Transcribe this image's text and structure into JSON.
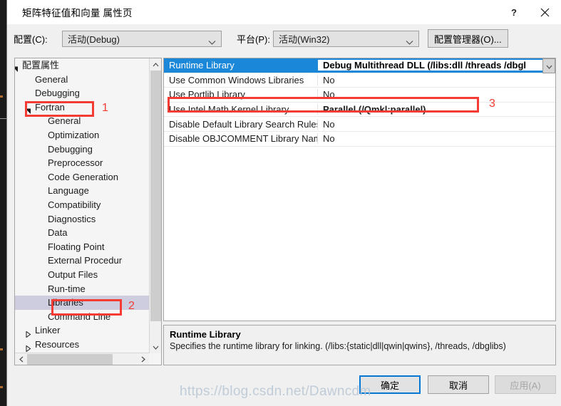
{
  "window": {
    "title": "矩阵特征值和向量 属性页",
    "help_label": "?",
    "close_label": "✕",
    "help_icon": "question-mark-icon",
    "close_icon": "close-icon"
  },
  "config_bar": {
    "config_label": "配置(C):",
    "config_value": "活动(Debug)",
    "platform_label": "平台(P):",
    "platform_value": "活动(Win32)",
    "config_manager_button": "配置管理器(O)..."
  },
  "tree": {
    "items": [
      {
        "label": "配置属性",
        "indent": 0,
        "glyph": "expanded",
        "selected": false
      },
      {
        "label": "General",
        "indent": 1,
        "glyph": "none",
        "selected": false
      },
      {
        "label": "Debugging",
        "indent": 1,
        "glyph": "none",
        "selected": false
      },
      {
        "label": "Fortran",
        "indent": 1,
        "glyph": "expanded",
        "selected": false
      },
      {
        "label": "General",
        "indent": 2,
        "glyph": "none",
        "selected": false
      },
      {
        "label": "Optimization",
        "indent": 2,
        "glyph": "none",
        "selected": false
      },
      {
        "label": "Debugging",
        "indent": 2,
        "glyph": "none",
        "selected": false
      },
      {
        "label": "Preprocessor",
        "indent": 2,
        "glyph": "none",
        "selected": false
      },
      {
        "label": "Code Generation",
        "indent": 2,
        "glyph": "none",
        "selected": false
      },
      {
        "label": "Language",
        "indent": 2,
        "glyph": "none",
        "selected": false
      },
      {
        "label": "Compatibility",
        "indent": 2,
        "glyph": "none",
        "selected": false
      },
      {
        "label": "Diagnostics",
        "indent": 2,
        "glyph": "none",
        "selected": false
      },
      {
        "label": "Data",
        "indent": 2,
        "glyph": "none",
        "selected": false
      },
      {
        "label": "Floating Point",
        "indent": 2,
        "glyph": "none",
        "selected": false
      },
      {
        "label": "External Procedur",
        "indent": 2,
        "glyph": "none",
        "selected": false
      },
      {
        "label": "Output Files",
        "indent": 2,
        "glyph": "none",
        "selected": false
      },
      {
        "label": "Run-time",
        "indent": 2,
        "glyph": "none",
        "selected": false
      },
      {
        "label": "Libraries",
        "indent": 2,
        "glyph": "none",
        "selected": true
      },
      {
        "label": "Command Line",
        "indent": 2,
        "glyph": "none",
        "selected": false
      },
      {
        "label": "Linker",
        "indent": 1,
        "glyph": "collapsed",
        "selected": false
      },
      {
        "label": "Resources",
        "indent": 1,
        "glyph": "collapsed",
        "selected": false
      }
    ]
  },
  "grid": {
    "rows": [
      {
        "name": "Runtime Library",
        "value": "Debug Multithread DLL (/libs:dll /threads /dbgl",
        "selected": true,
        "bold_value": true,
        "has_dropdown": true
      },
      {
        "name": "Use Common Windows Libraries",
        "value": "No",
        "selected": false,
        "bold_value": false,
        "has_dropdown": false
      },
      {
        "name": "Use Portlib Library",
        "value": "No",
        "selected": false,
        "bold_value": false,
        "has_dropdown": false
      },
      {
        "name": "Use Intel Math Kernel Library",
        "value": "Parallel (/Qmkl:parallel)",
        "selected": false,
        "bold_value": true,
        "has_dropdown": false
      },
      {
        "name": "Disable Default Library Search Rules",
        "value": "No",
        "selected": false,
        "bold_value": false,
        "has_dropdown": false
      },
      {
        "name": "Disable OBJCOMMENT Library Nam",
        "value": "No",
        "selected": false,
        "bold_value": false,
        "has_dropdown": false
      }
    ]
  },
  "description": {
    "title": "Runtime Library",
    "body": "Specifies the runtime library for linking. (/libs:{static|dll|qwin|qwins}, /threads, /dbglibs)"
  },
  "buttons": {
    "ok": "确定",
    "cancel": "取消",
    "apply": "应用(A)"
  },
  "annotations": {
    "one": "1",
    "two": "2",
    "three": "3"
  },
  "watermark": {
    "text": "https://blog.csdn.net/Dawncdm"
  },
  "colors": {
    "accent_blue": "#1a87d8",
    "annotation_red": "#f43b34",
    "selection_lavender": "#cdcddf",
    "dialog_bg": "#f0f0f0",
    "focus_border": "#0078d7"
  }
}
